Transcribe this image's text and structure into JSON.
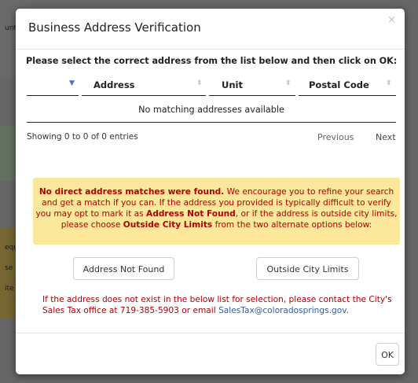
{
  "background": {
    "fragments": [
      "unt",
      "equ",
      "se",
      "ite"
    ]
  },
  "modal": {
    "title": "Business Address Verification",
    "close_glyph": "×",
    "instruction": "Please select the correct address from the list below and then click on OK:",
    "table": {
      "columns": [
        "Address",
        "Unit",
        "Postal Code"
      ],
      "empty_text": "No matching addresses available"
    },
    "info": "Showing 0 to 0 of 0 entries",
    "pager": {
      "previous": "Previous",
      "next": "Next"
    },
    "warning": {
      "bold_lead": "No direct address matches were found.",
      "text_1": " We encourage you to refine your search and get a match if you can. If the address you provided is typically difficult to verify you may opt to mark it as ",
      "bold_not_found": "Address Not Found",
      "text_2": ", or if the address is outside city limits, please choose ",
      "bold_outside": "Outside City Limits",
      "text_3": " from the two alternate options below:"
    },
    "buttons": {
      "not_found": "Address Not Found",
      "outside": "Outside City Limits",
      "ok": "OK"
    },
    "note": {
      "text": "If the address does not exist in the below list for selection, please contact the City's Sales Tax office at 719-385-5903 or email ",
      "email": "SalesTax@coloradosprings.gov",
      "end": "."
    }
  },
  "colors": {
    "warning_bg": "#fce89a",
    "warning_text": "#b00000",
    "link": "#2a5db0",
    "sort_active": "#4a6fc7"
  }
}
